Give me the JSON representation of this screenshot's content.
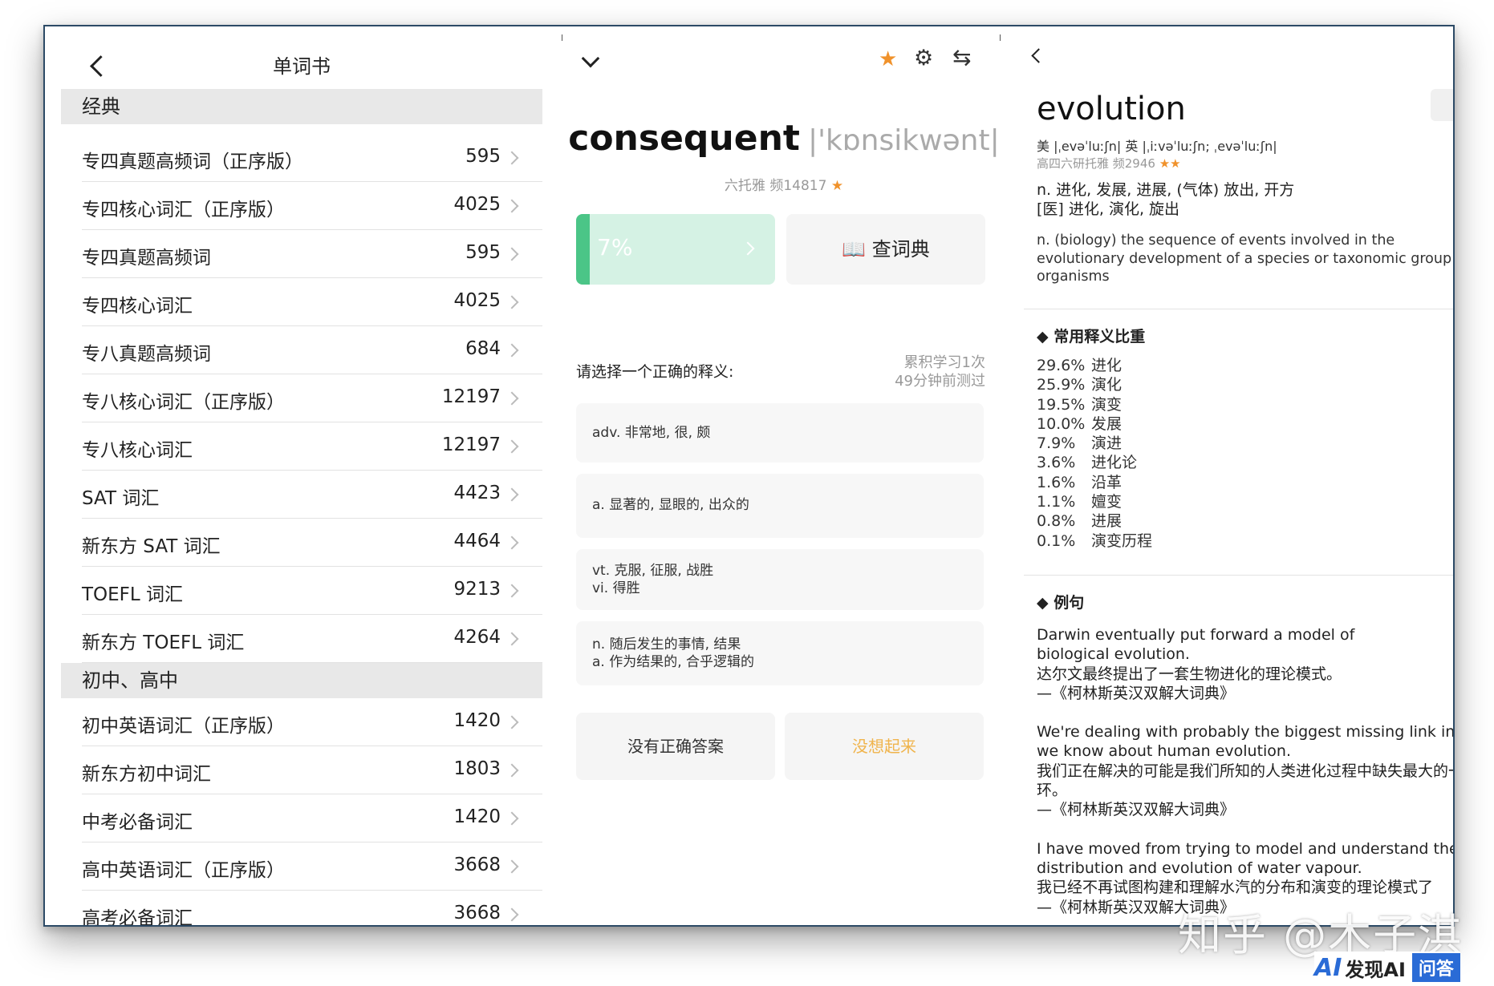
{
  "wordbook": {
    "title": "单词书",
    "sections": [
      {
        "header": "经典",
        "items": [
          {
            "name": "专四真题高频词（正序版）",
            "count": "595"
          },
          {
            "name": "专四核心词汇（正序版）",
            "count": "4025"
          },
          {
            "name": "专四真题高频词",
            "count": "595"
          },
          {
            "name": "专四核心词汇",
            "count": "4025"
          },
          {
            "name": "专八真题高频词",
            "count": "684"
          },
          {
            "name": "专八核心词汇（正序版）",
            "count": "12197"
          },
          {
            "name": "专八核心词汇",
            "count": "12197"
          },
          {
            "name": "SAT 词汇",
            "count": "4423"
          },
          {
            "name": "新东方 SAT 词汇",
            "count": "4464"
          },
          {
            "name": "TOEFL 词汇",
            "count": "9213"
          },
          {
            "name": "新东方 TOEFL 词汇",
            "count": "4264"
          }
        ]
      },
      {
        "header": "初中、高中",
        "items": [
          {
            "name": "初中英语词汇（正序版）",
            "count": "1420"
          },
          {
            "name": "新东方初中词汇",
            "count": "1803"
          },
          {
            "name": "中考必备词汇",
            "count": "1420"
          },
          {
            "name": "高中英语词汇（正序版）",
            "count": "3668"
          },
          {
            "name": "高考必备词汇",
            "count": "3668"
          }
        ]
      }
    ]
  },
  "quiz": {
    "word": "consequent",
    "phonetic": "|'kɒnsikwənt|",
    "meta": "六托雅 频14817",
    "meta_star": "★",
    "progress": {
      "label": "7%",
      "value": 0.07
    },
    "dict_button": "📖 查词典",
    "prompt": "请选择一个正确的释义:",
    "study_count": "累积学习1次",
    "last_test": "49分钟前测过",
    "options": [
      {
        "lines": [
          "adv. 非常地, 很, 颇"
        ]
      },
      {
        "lines": [
          "a. 显著的, 显眼的, 出众的"
        ]
      },
      {
        "lines": [
          "vt. 克服, 征服, 战胜",
          "vi. 得胜"
        ]
      },
      {
        "lines": [
          "n. 随后发生的事情, 结果",
          "a. 作为结果的, 合乎逻辑的"
        ]
      }
    ],
    "no_answer": "没有正确答案",
    "forgot": "没想起来",
    "colors": {
      "accent": "#f0922b",
      "forgot": "#f0b44c",
      "progress_fill": "#4bc587",
      "progress_bg": "#d5f2e4"
    }
  },
  "dictionary": {
    "headword": "evolution",
    "pronunciation": "美 |ˌevəˈluːʃn| 英 |ˌiːvəˈluːʃn; ˌevəˈluːʃn|",
    "tags": "高四六研托雅 频2946",
    "tag_stars": "★★",
    "def_cn": [
      "n. 进化, 发展, 进展, (气体) 放出, 开方",
      "[医] 进化, 演化, 旋出"
    ],
    "def_en": "n. (biology) the sequence of events involved in the evolutionary development of a species or taxonomic group of organisms",
    "freq_title": "◆ 常用释义比重",
    "freq": [
      {
        "pct": "29.6%",
        "label": "进化"
      },
      {
        "pct": "25.9%",
        "label": "演化"
      },
      {
        "pct": "19.5%",
        "label": "演变"
      },
      {
        "pct": "10.0%",
        "label": "发展"
      },
      {
        "pct": "7.9%",
        "label": "演进"
      },
      {
        "pct": "3.6%",
        "label": "进化论"
      },
      {
        "pct": "1.6%",
        "label": "沿革"
      },
      {
        "pct": "1.1%",
        "label": "嬗变"
      },
      {
        "pct": "0.8%",
        "label": "进展"
      },
      {
        "pct": "0.1%",
        "label": "演变历程"
      }
    ],
    "examples_title": "◆ 例句",
    "examples": [
      {
        "en": [
          "Darwin eventually put forward a model of",
          "biological evolution."
        ],
        "zh": "达尔文最终提出了一套生物进化的理论模式。",
        "src": "—《柯林斯英汉双解大词典》"
      },
      {
        "en": [
          "We're dealing with probably the biggest missing link in w",
          "we know about human evolution."
        ],
        "zh": "我们正在解决的可能是我们所知的人类进化过程中缺失最大的一环。",
        "src": "—《柯林斯英汉双解大词典》"
      },
      {
        "en": [
          "I have moved from trying to model and understand the",
          "distribution and evolution of water vapour."
        ],
        "zh": "我已经不再试图构建和理解水汽的分布和演变的理论模式了",
        "src": "—《柯林斯英汉双解大词典》"
      }
    ]
  },
  "watermark": {
    "zhihu": "知乎 @木子淇",
    "logo": "AI",
    "brand": "发现AI",
    "qa": "问答"
  }
}
